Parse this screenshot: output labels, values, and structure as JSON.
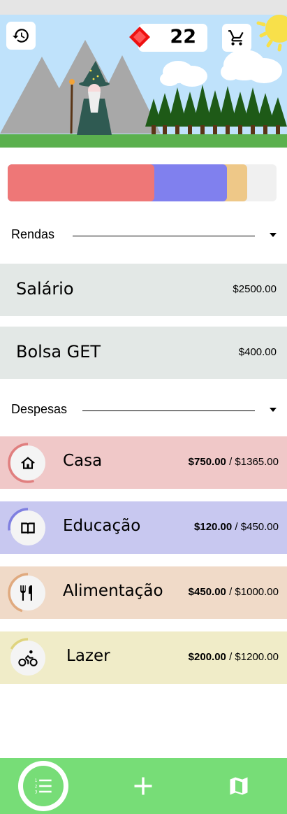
{
  "hud": {
    "gems": "22"
  },
  "budget_bar": {
    "segments": [
      {
        "name": "Casa",
        "fraction": 0.545,
        "color": "#ee7777"
      },
      {
        "name": "Educação",
        "fraction": 0.27,
        "color": "#8080ee"
      },
      {
        "name": "Alimentação",
        "fraction": 0.075,
        "color": "#eec888"
      }
    ]
  },
  "income_section": {
    "label": "Rendas",
    "items": [
      {
        "name": "Salário",
        "amount": "$2500.00"
      },
      {
        "name": "Bolsa GET",
        "amount": "$400.00"
      }
    ]
  },
  "expense_section": {
    "label": "Despesas",
    "items": [
      {
        "name": "Casa",
        "spent": "$750.00",
        "sep": " / ",
        "budget": "$1365.00",
        "icon": "home-icon",
        "bg": "#f0c8c8",
        "ring": "#e07f7f",
        "progress": 0.55
      },
      {
        "name": "Educação",
        "spent": "$120.00",
        "sep": " / ",
        "budget": "$450.00",
        "icon": "book-icon",
        "bg": "#c8c8f0",
        "ring": "#7f7fe0",
        "progress": 0.27
      },
      {
        "name": "Alimentação",
        "spent": "$450.00",
        "sep": " / ",
        "budget": "$1000.00",
        "icon": "restaurant-icon",
        "bg": "#f0dac8",
        "ring": "#e0aa7f",
        "progress": 0.45
      },
      {
        "name": "Lazer",
        "spent": "$200.00",
        "sep": " / ",
        "budget": "$1200.00",
        "icon": "bike-icon",
        "bg": "#f0ecc8",
        "ring": "#dfd47f",
        "progress": 0.17
      }
    ]
  },
  "colors": {
    "nav": "#77dd77",
    "sky": "#bfe2fb",
    "grass": "#5bb04e"
  }
}
